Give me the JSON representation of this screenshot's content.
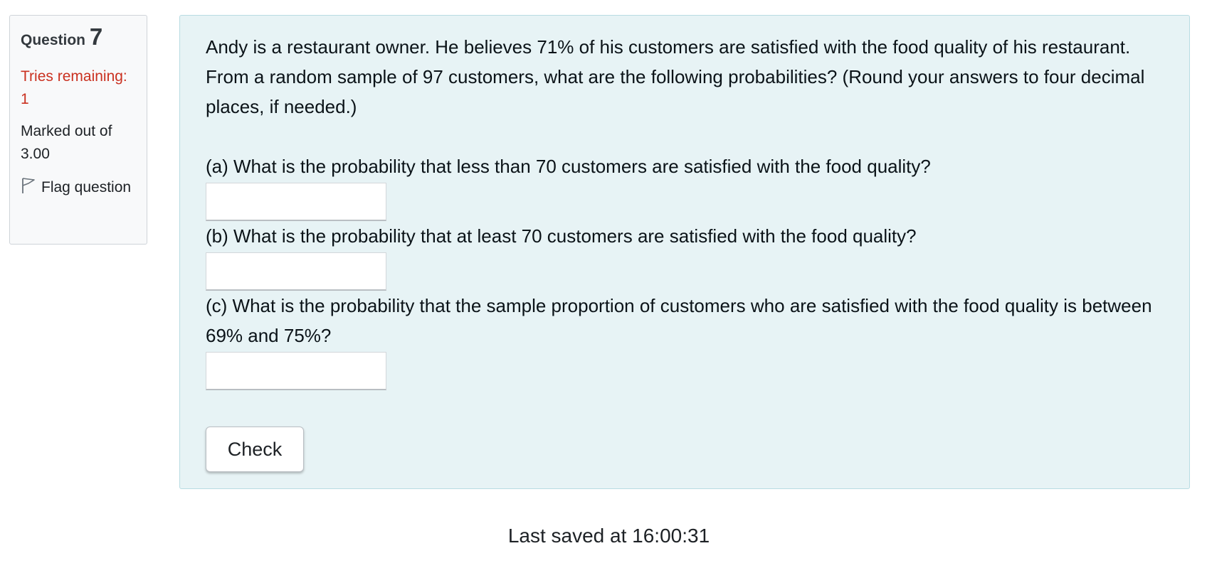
{
  "info": {
    "question_label": "Question",
    "question_number": "7",
    "tries_remaining": "Tries remaining: 1",
    "marked_out_of": "Marked out of 3.00",
    "flag_label": "Flag question"
  },
  "question": {
    "text": "Andy is a restaurant owner. He believes 71% of his customers are satisfied with the food quality of his restaurant. From a random sample of 97 customers, what are the following probabilities? (Round your answers to four decimal places, if needed.)",
    "parts": [
      {
        "text": "(a) What is the probability that less than 70 customers are satisfied with the food quality?",
        "value": ""
      },
      {
        "text": "(b) What is the probability that at least 70 customers are satisfied with the food quality?",
        "value": ""
      },
      {
        "text": "(c) What is the probability that the sample proportion of customers who are satisfied with the food quality is between 69% and 75%?",
        "value": ""
      }
    ],
    "check_label": "Check"
  },
  "footer": {
    "last_saved": "Last saved at 16:00:31"
  },
  "icons": {
    "flag": "flag-icon"
  },
  "colors": {
    "tries_text": "#ca3120",
    "content_background": "#e7f3f5",
    "content_border": "#b8dce2",
    "info_background": "#f8f9fa"
  }
}
